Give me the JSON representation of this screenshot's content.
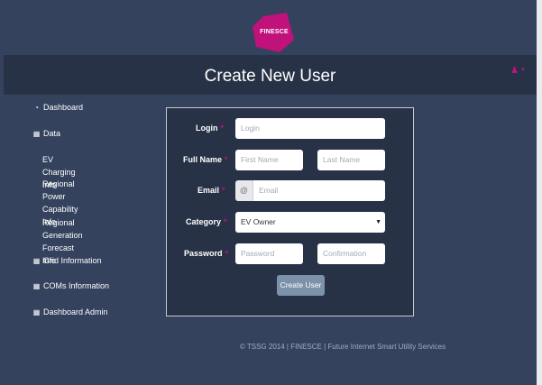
{
  "brand": {
    "logo_text": "FINESCE",
    "accent": "#c0127a"
  },
  "header": {
    "title": "Create New User",
    "user_menu_icon": "user-icon"
  },
  "sidebar": {
    "items": [
      {
        "icon": "dashboard-icon",
        "label": "Dashboard"
      },
      {
        "icon": "chart-icon",
        "label": "Data"
      },
      {
        "icon": "chart-icon",
        "label": "Grid Information"
      },
      {
        "icon": "chart-icon",
        "label": "COMs Information"
      },
      {
        "icon": "chart-icon",
        "label": "Dashboard Admin"
      }
    ],
    "subitems": [
      {
        "line1": "EV Charging Info",
        "line2": ""
      },
      {
        "line1": "Regional Power",
        "line2": "Capability Info"
      },
      {
        "line1": "Regional Generation",
        "line2": "Forecast Info"
      }
    ]
  },
  "form": {
    "login": {
      "label": "Login",
      "placeholder": "Login"
    },
    "full_name": {
      "label": "Full Name",
      "first_placeholder": "First Name",
      "last_placeholder": "Last Name"
    },
    "email": {
      "label": "Email",
      "addon": "@",
      "placeholder": "Email"
    },
    "category": {
      "label": "Category",
      "selected": "EV Owner"
    },
    "password": {
      "label": "Password",
      "placeholder": "Password",
      "confirm_placeholder": "Confirmation"
    },
    "required_marker": "*",
    "submit_label": "Create User"
  },
  "footer": {
    "text": "© TSSG 2014 | FINESCE | Future Internet Smart Utility Services"
  }
}
